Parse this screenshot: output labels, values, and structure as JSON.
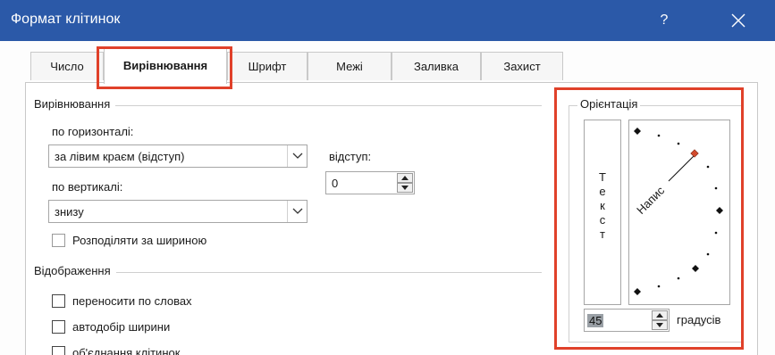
{
  "window": {
    "title": "Формат клітинок",
    "help": "?"
  },
  "tabs": [
    {
      "label": "Число"
    },
    {
      "label": "Вирівнювання"
    },
    {
      "label": "Шрифт"
    },
    {
      "label": "Межі"
    },
    {
      "label": "Заливка"
    },
    {
      "label": "Захист"
    }
  ],
  "alignment": {
    "section": "Вирівнювання",
    "horizontal_label": "по горизонталі:",
    "horizontal_value": "за лівим краєм (відступ)",
    "vertical_label": "по вертикалі:",
    "vertical_value": "знизу",
    "indent_label": "відступ:",
    "indent_value": "0",
    "distribute_label": "Розподіляти за шириною"
  },
  "display": {
    "section": "Відображення",
    "wrap_label": "переносити по словах",
    "shrink_label": "автодобір ширини",
    "merge_label": "об'єднання клітинок"
  },
  "orientation": {
    "section": "Орієнтація",
    "vertical_text": [
      "Т",
      "е",
      "к",
      "с",
      "т"
    ],
    "dial_text": "Напис",
    "degrees_value": "45",
    "degrees_label": "градусів"
  }
}
